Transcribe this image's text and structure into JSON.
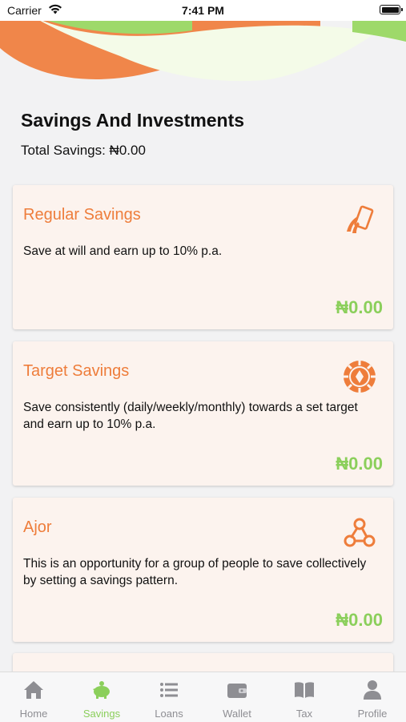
{
  "status_bar": {
    "carrier": "Carrier",
    "time": "7:41 PM"
  },
  "page": {
    "title": "Savings And Investments",
    "total_savings": "Total Savings: ₦0.00"
  },
  "cards": [
    {
      "title": "Regular Savings",
      "description": "Save at will and earn up to 10% p.a.",
      "amount": "₦0.00",
      "icon": "savings-card-icon"
    },
    {
      "title": "Target Savings",
      "description": "Save consistently (daily/weekly/monthly) towards a set target and earn up to 10% p.a.",
      "amount": "₦0.00",
      "icon": "target-chip-icon"
    },
    {
      "title": "Ajor",
      "description": "This is an opportunity for a group of people to save collectively by setting a savings pattern.",
      "amount": "₦0.00",
      "icon": "group-network-icon"
    }
  ],
  "tabs": [
    {
      "label": "Home",
      "icon": "home-icon"
    },
    {
      "label": "Savings",
      "icon": "piggy-bank-icon",
      "active": true
    },
    {
      "label": "Loans",
      "icon": "list-icon"
    },
    {
      "label": "Wallet",
      "icon": "wallet-icon"
    },
    {
      "label": "Tax",
      "icon": "book-icon"
    },
    {
      "label": "Profile",
      "icon": "profile-icon"
    }
  ],
  "colors": {
    "accent_orange": "#ee7d3b",
    "accent_green": "#8bcf5b",
    "card_bg": "#fcf3ee"
  }
}
